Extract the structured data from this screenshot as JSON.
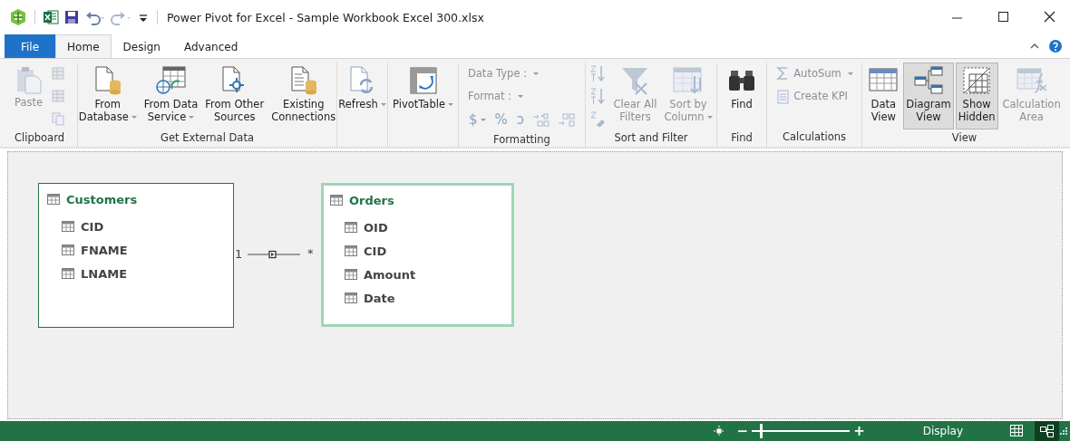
{
  "window": {
    "title": "Power Pivot for Excel - Sample Workbook Excel 300.xlsx"
  },
  "tabs": [
    {
      "label": "File",
      "kind": "file",
      "selected": false
    },
    {
      "label": "Home",
      "kind": "tab",
      "selected": true
    },
    {
      "label": "Design",
      "kind": "tab",
      "selected": false
    },
    {
      "label": "Advanced",
      "kind": "tab",
      "selected": false
    }
  ],
  "ribbon": {
    "groups": [
      {
        "label": "Clipboard",
        "stacks": [
          [
            {
              "kind": "large",
              "lines": [
                "Paste"
              ],
              "disabled": true,
              "menu": false
            }
          ],
          [
            {
              "kind": "icon",
              "disabled": true,
              "menu": false
            },
            {
              "kind": "icon",
              "disabled": true,
              "menu": false
            },
            {
              "kind": "icon",
              "disabled": true,
              "menu": false
            }
          ]
        ]
      },
      {
        "label": "Get External Data",
        "stacks": [
          [
            {
              "kind": "large",
              "lines": [
                "From",
                "Database"
              ],
              "disabled": false,
              "menu": true
            }
          ],
          [
            {
              "kind": "large",
              "lines": [
                "From Data",
                "Service"
              ],
              "disabled": false,
              "menu": true
            }
          ],
          [
            {
              "kind": "large",
              "lines": [
                "From Other",
                "Sources"
              ],
              "disabled": false,
              "menu": false
            }
          ],
          [
            {
              "kind": "large",
              "lines": [
                "Existing",
                "Connections"
              ],
              "disabled": false,
              "menu": false
            }
          ]
        ]
      },
      {
        "stacks": [
          [
            {
              "kind": "large",
              "lines": [
                "Refresh"
              ],
              "disabled": false,
              "menu": true
            }
          ]
        ]
      },
      {
        "stacks": [
          [
            {
              "kind": "large",
              "lines": [
                "PivotTable"
              ],
              "disabled": false,
              "menu": true
            }
          ]
        ]
      },
      {
        "label": "Formatting",
        "stacks": [
          [
            {
              "kind": "small",
              "lines": [
                "Data Type :"
              ],
              "disabled": true,
              "menu": true
            },
            {
              "kind": "small",
              "lines": [
                "Format :"
              ],
              "disabled": true,
              "menu": true
            },
            {
              "kind": "row",
              "items": [
                {
                  "kind": "glyph",
                  "lines": [
                    "$"
                  ],
                  "disabled": true,
                  "menu": true
                },
                {
                  "kind": "glyph",
                  "lines": [
                    "%"
                  ],
                  "disabled": true,
                  "menu": false
                },
                {
                  "kind": "glyph",
                  "lines": [
                    "ͻ"
                  ],
                  "disabled": true,
                  "menu": false
                },
                {
                  "kind": "icon",
                  "disabled": true,
                  "menu": false
                },
                {
                  "kind": "icon",
                  "disabled": true,
                  "menu": false
                }
              ]
            }
          ]
        ]
      },
      {
        "label": "Sort and Filter",
        "stacks": [
          [
            {
              "kind": "icon",
              "disabled": true,
              "menu": false
            },
            {
              "kind": "icon",
              "disabled": true,
              "menu": false
            },
            {
              "kind": "icon",
              "disabled": true,
              "menu": false
            }
          ],
          [
            {
              "kind": "large",
              "lines": [
                "Clear All",
                "Filters"
              ],
              "disabled": true,
              "menu": false
            }
          ],
          [
            {
              "kind": "large",
              "lines": [
                "Sort by",
                "Column"
              ],
              "disabled": true,
              "menu": true
            }
          ]
        ]
      },
      {
        "label": "Find",
        "stacks": [
          [
            {
              "kind": "large",
              "lines": [
                "Find"
              ],
              "disabled": false,
              "menu": false
            }
          ]
        ]
      },
      {
        "label": "Calculations",
        "stacks": [
          [
            {
              "kind": "small",
              "lines": [
                "AutoSum"
              ],
              "disabled": true,
              "menu": true
            },
            {
              "kind": "small",
              "lines": [
                "Create KPI"
              ],
              "disabled": true,
              "menu": false
            }
          ]
        ]
      },
      {
        "label": "View",
        "stacks": [
          [
            {
              "kind": "large",
              "lines": [
                "Data",
                "View"
              ],
              "disabled": false,
              "menu": false,
              "selected": false
            }
          ],
          [
            {
              "kind": "large",
              "lines": [
                "Diagram",
                "View"
              ],
              "disabled": false,
              "menu": false,
              "selected": true
            }
          ],
          [
            {
              "kind": "large",
              "lines": [
                "Show",
                "Hidden"
              ],
              "disabled": false,
              "menu": false,
              "selected": true
            }
          ],
          [
            {
              "kind": "large",
              "lines": [
                "Calculation",
                "Area"
              ],
              "disabled": true,
              "menu": false,
              "selected": false
            }
          ]
        ]
      }
    ]
  },
  "diagram": {
    "tables": [
      {
        "name": "Customers",
        "selected": false,
        "columns": [
          "CID",
          "FNAME",
          "LNAME"
        ]
      },
      {
        "name": "Orders",
        "selected": true,
        "columns": [
          "OID",
          "CID",
          "Amount",
          "Date"
        ]
      }
    ],
    "relationship": {
      "from_label": "1",
      "to_label": "*"
    }
  },
  "status_bar": {
    "zoom_out": "−",
    "zoom_in": "+",
    "zoom": {
      "level": 0.08
    },
    "display": "Display",
    "views": [
      {
        "kind": "grid",
        "selected": false
      },
      {
        "kind": "diagram",
        "selected": true
      }
    ]
  }
}
